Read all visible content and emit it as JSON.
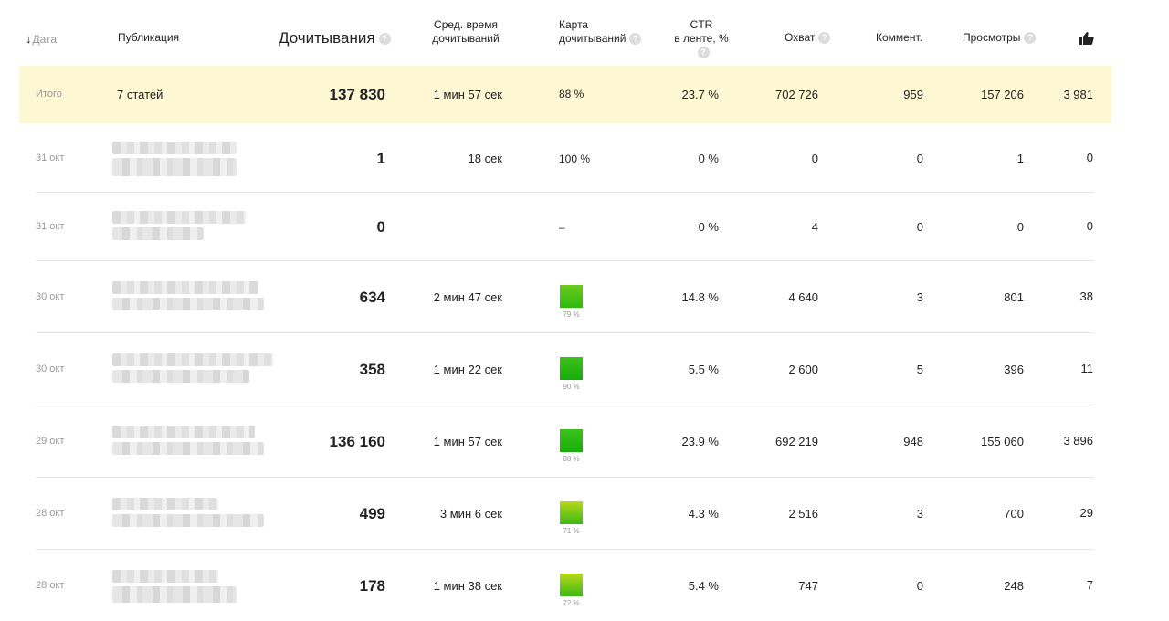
{
  "header": {
    "date": "Дата",
    "publication": "Публикация",
    "reads": "Дочитывания",
    "avg_time_line1": "Сред. время",
    "avg_time_line2": "дочитываний",
    "map_line1": "Карта",
    "map_line2": "дочитываний",
    "ctr_line1": "CTR",
    "ctr_line2": "в ленте, %",
    "reach": "Охват",
    "comments": "Коммент.",
    "views": "Просмотры",
    "help": "?",
    "sort_arrow": "↓",
    "likes_icon": "thumbs-up-icon"
  },
  "total": {
    "label": "Итого",
    "publication": "7 статей",
    "reads": "137 830",
    "avg_time": "1 мин 57 сек",
    "map": "88 %",
    "ctr": "23.7 %",
    "reach": "702 726",
    "comments": "959",
    "views": "157 206",
    "likes": "3 981"
  },
  "rows": [
    {
      "date": "31 окт",
      "reads": "1",
      "avg_time": "18 сек",
      "map_text": "100 %",
      "map_percent": null,
      "ctr": "0 %",
      "reach": "0",
      "comments": "0",
      "views": "1",
      "likes": "0"
    },
    {
      "date": "31 окт",
      "reads": "0",
      "avg_time": "",
      "map_text": "–",
      "map_percent": null,
      "ctr": "0 %",
      "reach": "4",
      "comments": "0",
      "views": "0",
      "likes": "0"
    },
    {
      "date": "30 окт",
      "reads": "634",
      "avg_time": "2 мин 47 сек",
      "map_text": "",
      "map_percent": "79 %",
      "ctr": "14.8 %",
      "reach": "4 640",
      "comments": "3",
      "views": "801",
      "likes": "38"
    },
    {
      "date": "30 окт",
      "reads": "358",
      "avg_time": "1 мин 22 сек",
      "map_text": "",
      "map_percent": "90 %",
      "ctr": "5.5 %",
      "reach": "2 600",
      "comments": "5",
      "views": "396",
      "likes": "11"
    },
    {
      "date": "29 окт",
      "reads": "136 160",
      "avg_time": "1 мин 57 сек",
      "map_text": "",
      "map_percent": "88 %",
      "ctr": "23.9 %",
      "reach": "692 219",
      "comments": "948",
      "views": "155 060",
      "likes": "3 896"
    },
    {
      "date": "28 окт",
      "reads": "499",
      "avg_time": "3 мин 6 сек",
      "map_text": "",
      "map_percent": "71 %",
      "ctr": "4.3 %",
      "reach": "2 516",
      "comments": "3",
      "views": "700",
      "likes": "29"
    },
    {
      "date": "28 окт",
      "reads": "178",
      "avg_time": "1 мин 38 сек",
      "map_text": "",
      "map_percent": "72 %",
      "ctr": "5.4 %",
      "reach": "747",
      "comments": "0",
      "views": "248",
      "likes": "7"
    }
  ],
  "colors": {
    "total_bg": "#fdf7d3",
    "map_green": "#2fb80f",
    "divider": "#e6e6e6",
    "muted_text": "#999999"
  }
}
